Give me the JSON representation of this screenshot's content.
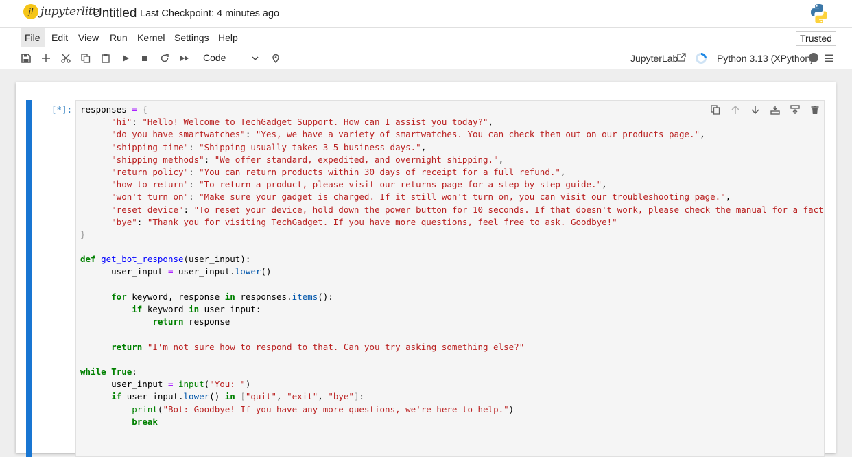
{
  "header": {
    "logo_text": "jupyterlite",
    "notebook_title": "Untitled",
    "checkpoint": "Last Checkpoint: 4 minutes ago"
  },
  "menu": {
    "items": [
      "File",
      "Edit",
      "View",
      "Run",
      "Kernel",
      "Settings",
      "Help"
    ],
    "active": "File",
    "trusted": "Trusted"
  },
  "toolbar": {
    "buttons": [
      "save-icon",
      "add-icon",
      "cut-icon",
      "copy-icon",
      "paste-icon",
      "run-icon",
      "stop-icon",
      "restart-icon",
      "fast-forward-icon"
    ],
    "cell_type": "Code",
    "jupyterlab_link": "JupyterLab",
    "kernel_name": "Python 3.13 (XPython)"
  },
  "cell": {
    "prompt": "[*]:",
    "code_lines": [
      "responses = {",
      "      \"hi\": \"Hello! Welcome to TechGadget Support. How can I assist you today?\",",
      "      \"do you have smartwatches\": \"Yes, we have a variety of smartwatches. You can check them out on our products page.\",",
      "      \"shipping time\": \"Shipping usually takes 3-5 business days.\",",
      "      \"shipping methods\": \"We offer standard, expedited, and overnight shipping.\",",
      "      \"return policy\": \"You can return products within 30 days of receipt for a full refund.\",",
      "      \"how to return\": \"To return a product, please visit our returns page for a step-by-step guide.\",",
      "      \"won't turn on\": \"Make sure your gadget is charged. If it still won't turn on, you can visit our troubleshooting page.\",",
      "      \"reset device\": \"To reset your device, hold down the power button for 10 seconds. If that doesn't work, please check the manual for a factory rese",
      "      \"bye\": \"Thank you for visiting TechGadget. If you have more questions, feel free to ask. Goodbye!\"",
      "}",
      "",
      "def get_bot_response(user_input):",
      "      user_input = user_input.lower()",
      "",
      "      for keyword, response in responses.items():",
      "          if keyword in user_input:",
      "              return response",
      "",
      "      return \"I'm not sure how to respond to that. Can you try asking something else?\"",
      "",
      "while True:",
      "      user_input = input(\"You: \")",
      "      if user_input.lower() in [\"quit\", \"exit\", \"bye\"]:",
      "          print(\"Bot: Goodbye! If you have any more questions, we're here to help.\")",
      "          break"
    ],
    "tools": [
      "duplicate-icon",
      "move-up-icon",
      "move-down-icon",
      "insert-above-icon",
      "insert-below-icon",
      "delete-icon"
    ]
  }
}
